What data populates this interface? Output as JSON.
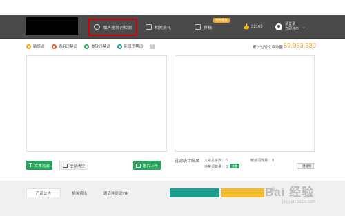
{
  "nav": {
    "items": [
      {
        "label": "图片违禁词检测"
      },
      {
        "label": "相关资讯"
      },
      {
        "label": "荐稿"
      }
    ],
    "badge": "限时免费",
    "likes": "32169",
    "login_line1": "请登录",
    "login_line2": "立即注册"
  },
  "filters": [
    {
      "label": "敏感词",
      "color": "#f0a11b"
    },
    {
      "label": "通用违禁词",
      "color": "#e45d2b"
    },
    {
      "label": "类较违禁词",
      "color": "#26a65b"
    },
    {
      "label": "新闻违禁词",
      "color": "#1b9c8d"
    }
  ],
  "help": "?",
  "total_label": "累计过滤文章数量：",
  "total_value": "59,053,330",
  "buttons": {
    "text_filter": "文本过滤",
    "clear_all": "全部清空",
    "image_upload": "图片上传"
  },
  "stats": {
    "title": "过滤统计结果",
    "total_words_label": "文章总字数：",
    "total_words": "0",
    "sensitive_label": "敏感词数量：",
    "sensitive": "0",
    "banned_label": "违禁词数量：",
    "banned": "0",
    "tag": "查看",
    "copy": "一键复制"
  },
  "footer": {
    "tabs": [
      "产品公告",
      "相关资讯",
      "邀请注册送VIP"
    ]
  },
  "watermark": {
    "text": "Bai 经验",
    "site": "jingyan.baidu.com"
  }
}
